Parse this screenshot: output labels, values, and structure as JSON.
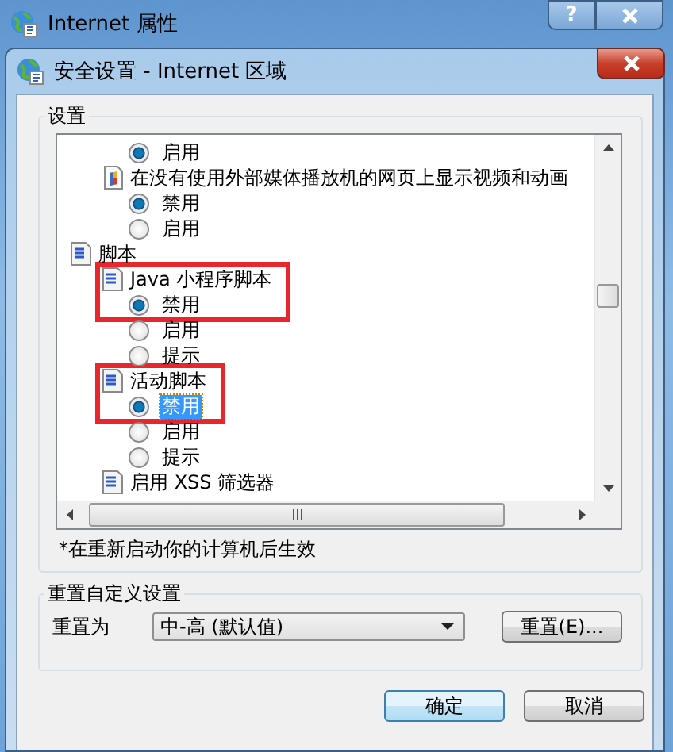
{
  "window": {
    "title": "Internet 属性",
    "help_button": "?"
  },
  "dialog": {
    "title": "安全设置 - Internet 区域"
  },
  "settings_group": {
    "label": "设置",
    "tree": [
      {
        "kind": "option",
        "label": "启用",
        "selected": true,
        "focused": false
      },
      {
        "kind": "media_setting",
        "label": "在没有使用外部媒体播放机的网页上显示视频和动画",
        "highlighted": false,
        "children": [
          {
            "kind": "option",
            "label": "禁用",
            "selected": true,
            "focused": false
          },
          {
            "kind": "option",
            "label": "启用",
            "selected": false,
            "focused": false
          }
        ]
      },
      {
        "kind": "category",
        "label": "脚本",
        "children": [
          {
            "kind": "script_setting",
            "label": "Java 小程序脚本",
            "highlighted": true,
            "children": [
              {
                "kind": "option",
                "label": "禁用",
                "selected": true,
                "focused": false
              },
              {
                "kind": "option",
                "label": "启用",
                "selected": false,
                "focused": false
              },
              {
                "kind": "option",
                "label": "提示",
                "selected": false,
                "focused": false
              }
            ]
          },
          {
            "kind": "script_setting",
            "label": "活动脚本",
            "highlighted": true,
            "children": [
              {
                "kind": "option",
                "label": "禁用",
                "selected": true,
                "focused": true
              },
              {
                "kind": "option",
                "label": "启用",
                "selected": false,
                "focused": false
              },
              {
                "kind": "option",
                "label": "提示",
                "selected": false,
                "focused": false
              }
            ]
          },
          {
            "kind": "script_setting",
            "label": "启用 XSS 筛选器",
            "highlighted": false
          }
        ]
      }
    ],
    "note": "*在重新启动你的计算机后生效"
  },
  "reset_group": {
    "label": "重置自定义设置",
    "field_label": "重置为",
    "value": "中-高 (默认值)",
    "button": "重置(E)..."
  },
  "buttons": [
    {
      "label": "确定",
      "default": true
    },
    {
      "label": "取消",
      "default": false
    }
  ]
}
